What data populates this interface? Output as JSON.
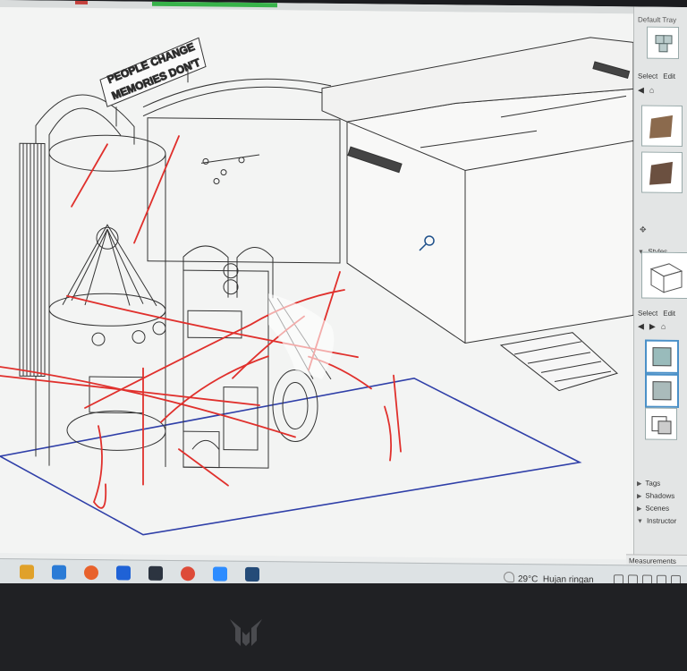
{
  "window": {
    "app": "SketchUp"
  },
  "model": {
    "sign_text_line1": "PEOPLE CHANGE",
    "sign_text_line2": "MEMORIES DON'T"
  },
  "tray": {
    "title": "Default Tray",
    "select_label": "Select",
    "edit_label": "Edit",
    "styles_label": "Styles",
    "select2_label": "Select",
    "edit2_label": "Edit",
    "panels": [
      {
        "label": "Tags"
      },
      {
        "label": "Shadows"
      },
      {
        "label": "Scenes"
      },
      {
        "label": "Instructor"
      }
    ]
  },
  "measurements_label": "Measurements",
  "taskbar": {
    "apps": [
      {
        "name": "file-explorer-icon",
        "color": "#e0a12a"
      },
      {
        "name": "mail-icon",
        "color": "#2a7bd6"
      },
      {
        "name": "firefox-icon",
        "color": "#e8622c"
      },
      {
        "name": "dropbox-icon",
        "color": "#1f62d6"
      },
      {
        "name": "reader-icon",
        "color": "#2c3440"
      },
      {
        "name": "chrome-icon",
        "color": "#dd4b39"
      },
      {
        "name": "zoom-icon",
        "color": "#2d8cff"
      },
      {
        "name": "sketchup-icon",
        "color": "#244b78"
      }
    ],
    "temperature": "29°C",
    "weather": "Hujan ringan"
  },
  "colors": {
    "accent_red": "#e0302c",
    "ground_blue": "#2f3fa8",
    "select_blue": "#4a90c8"
  }
}
